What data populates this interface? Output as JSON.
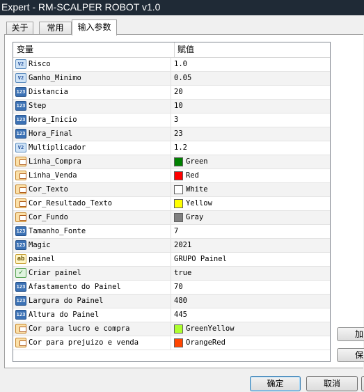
{
  "window": {
    "title": "Expert - RM-SCALPER ROBOT v1.0"
  },
  "tabs": [
    {
      "label": "关于"
    },
    {
      "label": "常用"
    },
    {
      "label": "输入参数",
      "active": true
    }
  ],
  "table": {
    "headers": {
      "variable": "变量",
      "value": "赋值"
    },
    "rows": [
      {
        "icon": "double-param-icon",
        "name": "Risco",
        "value": "1.0"
      },
      {
        "icon": "double-param-icon",
        "name": "Ganho_Minimo",
        "value": "0.05"
      },
      {
        "icon": "int-param-icon",
        "name": "Distancia",
        "value": "20"
      },
      {
        "icon": "int-param-icon",
        "name": "Step",
        "value": "10"
      },
      {
        "icon": "int-param-icon",
        "name": "Hora_Inicio",
        "value": "3"
      },
      {
        "icon": "int-param-icon",
        "name": "Hora_Final",
        "value": "23"
      },
      {
        "icon": "double-param-icon",
        "name": "Multiplicador",
        "value": "1.2"
      },
      {
        "icon": "color-param-icon",
        "name": "Linha_Compra",
        "value": "Green",
        "color": "#008000"
      },
      {
        "icon": "color-param-icon",
        "name": "Linha_Venda",
        "value": "Red",
        "color": "#ff0000"
      },
      {
        "icon": "color-param-icon",
        "name": "Cor_Texto",
        "value": "White",
        "color": "#ffffff"
      },
      {
        "icon": "color-param-icon",
        "name": "Cor_Resultado_Texto",
        "value": "Yellow",
        "color": "#ffff00"
      },
      {
        "icon": "color-param-icon",
        "name": "Cor_Fundo",
        "value": "Gray",
        "color": "#808080"
      },
      {
        "icon": "int-param-icon",
        "name": "Tamanho_Fonte",
        "value": "7"
      },
      {
        "icon": "int-param-icon",
        "name": "Magic",
        "value": "2021"
      },
      {
        "icon": "string-param-icon",
        "name": "painel",
        "value": "GRUPO Painel"
      },
      {
        "icon": "bool-param-icon",
        "name": "Criar painel",
        "value": "true"
      },
      {
        "icon": "int-param-icon",
        "name": "Afastamento do Painel",
        "value": "70"
      },
      {
        "icon": "int-param-icon",
        "name": "Largura do Painel",
        "value": "480"
      },
      {
        "icon": "int-param-icon",
        "name": "Altura do Painel",
        "value": "445"
      },
      {
        "icon": "color-param-icon",
        "name": "Cor para lucro e compra",
        "value": "GreenYellow",
        "color": "#adff2f"
      },
      {
        "icon": "color-param-icon",
        "name": "Cor para prejuizo e venda",
        "value": "OrangeRed",
        "color": "#ff4500"
      }
    ]
  },
  "side_buttons": {
    "load_label": "加",
    "save_label": "保"
  },
  "footer": {
    "ok_label": "确定",
    "cancel_label": "取消"
  }
}
